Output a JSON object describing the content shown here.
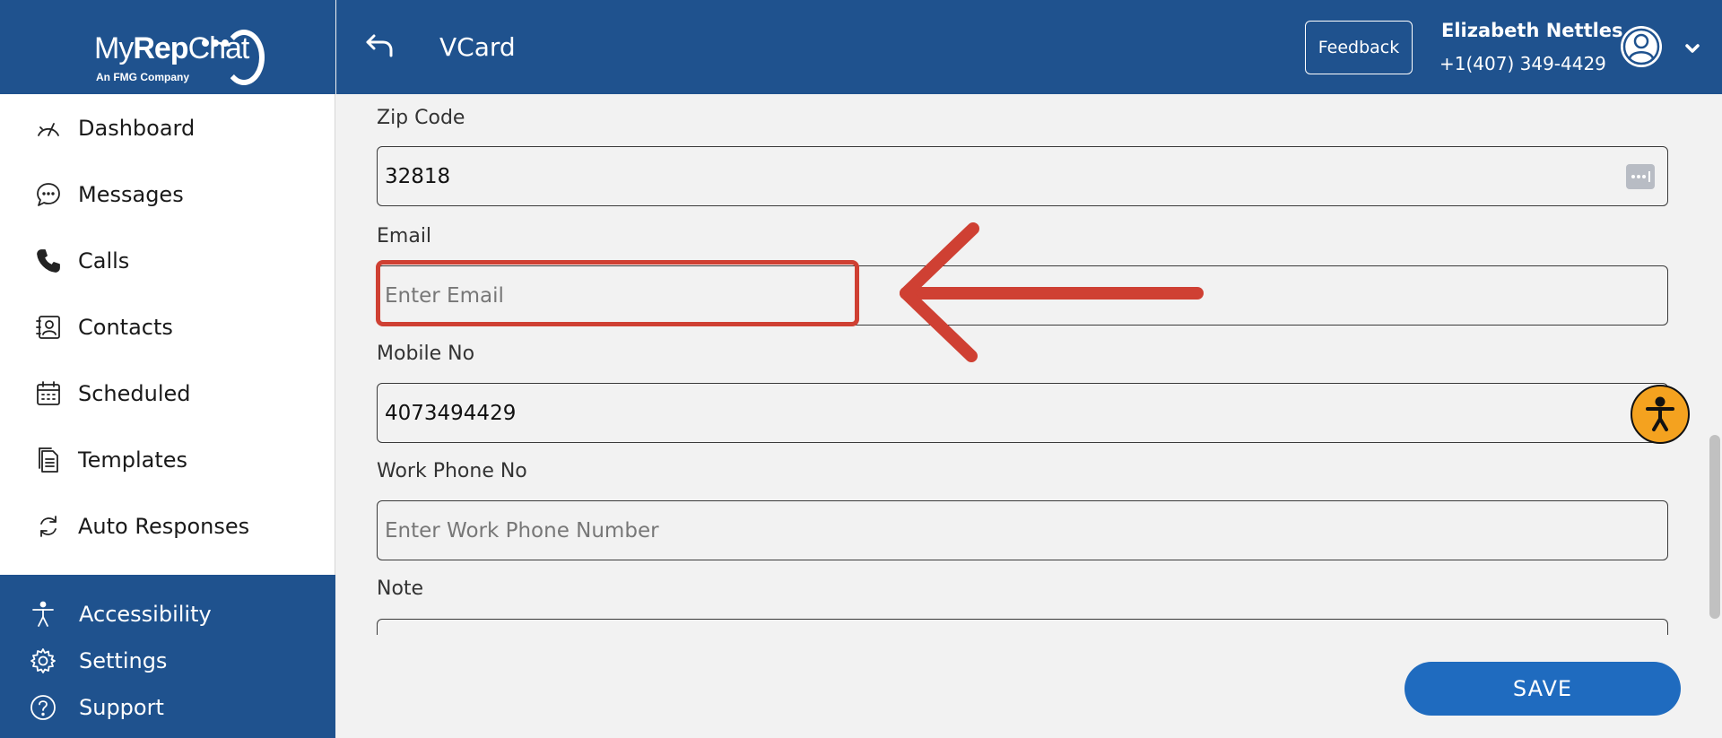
{
  "app": {
    "brand_prefix": "My",
    "brand_bold": "Rep",
    "brand_suffix": "Chat",
    "tagline": "An FMG Company"
  },
  "header": {
    "title": "VCard",
    "feedback_label": "Feedback",
    "user_name": "Elizabeth Nettles",
    "user_phone": "+1(407) 349-4429"
  },
  "sidebar": {
    "items": [
      {
        "label": "Dashboard",
        "icon": "gauge-icon"
      },
      {
        "label": "Messages",
        "icon": "chat-bubble-icon"
      },
      {
        "label": "Calls",
        "icon": "phone-icon"
      },
      {
        "label": "Contacts",
        "icon": "contact-card-icon"
      },
      {
        "label": "Scheduled",
        "icon": "calendar-icon"
      },
      {
        "label": "Templates",
        "icon": "document-icon"
      },
      {
        "label": "Auto Responses",
        "icon": "refresh-icon"
      }
    ],
    "bottom_items": [
      {
        "label": "Accessibility",
        "icon": "accessibility-icon"
      },
      {
        "label": "Settings",
        "icon": "gear-icon"
      },
      {
        "label": "Support",
        "icon": "help-circle-icon"
      }
    ]
  },
  "form": {
    "zip": {
      "label": "Zip Code",
      "value": "32818"
    },
    "email": {
      "label": "Email",
      "value": "",
      "placeholder": "Enter Email"
    },
    "mobile": {
      "label": "Mobile No",
      "value": "4073494429"
    },
    "work_phone": {
      "label": "Work Phone No",
      "value": "",
      "placeholder": "Enter Work Phone Number"
    },
    "note": {
      "label": "Note",
      "value": ""
    }
  },
  "actions": {
    "save_label": "SAVE"
  },
  "colors": {
    "primary": "#1f528e",
    "save_button": "#1f6bbf",
    "annotation": "#cf4033",
    "accessibility_widget": "#f4a21f",
    "background": "#f2f2f2"
  }
}
